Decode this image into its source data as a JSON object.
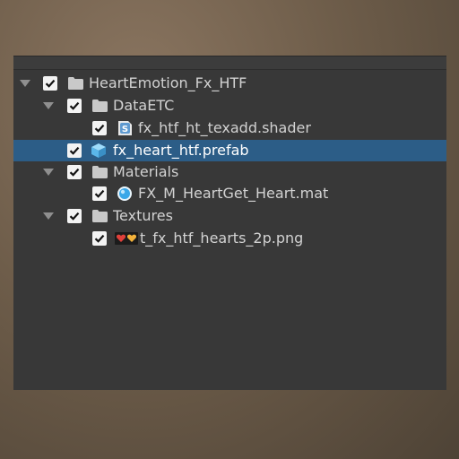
{
  "hierarchy": {
    "items": [
      {
        "label": "HeartEmotion_Fx_HTF",
        "icon": "folder-icon",
        "expanded": true,
        "checked": true
      },
      {
        "label": "DataETC",
        "icon": "folder-icon",
        "expanded": true,
        "checked": true
      },
      {
        "label": "fx_htf_ht_texadd.shader",
        "icon": "shader-icon",
        "checked": true
      },
      {
        "label": "fx_heart_htf.prefab",
        "icon": "prefab-icon",
        "checked": true,
        "selected": true
      },
      {
        "label": "Materials",
        "icon": "folder-icon",
        "expanded": true,
        "checked": true
      },
      {
        "label": "FX_M_HeartGet_Heart.mat",
        "icon": "material-icon",
        "checked": true
      },
      {
        "label": "Textures",
        "icon": "folder-icon",
        "expanded": true,
        "checked": true
      },
      {
        "label": "t_fx_htf_hearts_2p.png",
        "icon": "texture-icon",
        "checked": true
      }
    ]
  },
  "colors": {
    "panel": "#383838",
    "selection": "#2c5d87",
    "text": "#d2d2d2",
    "prefab": "#5bb7ea",
    "material": "#3aa7e8"
  }
}
